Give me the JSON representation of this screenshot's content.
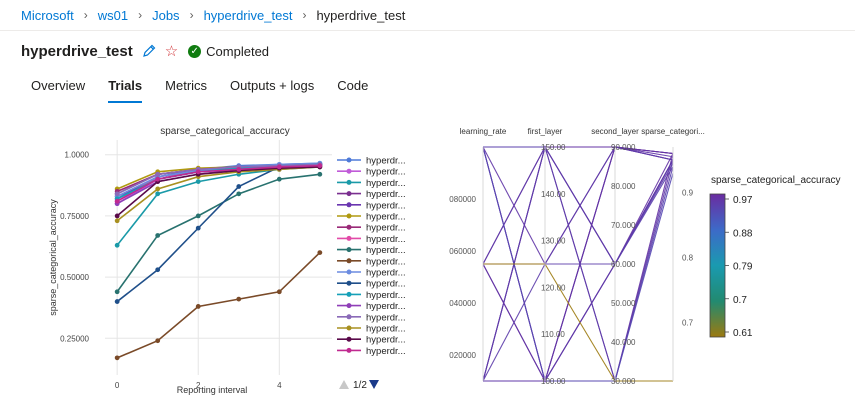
{
  "breadcrumb": [
    "Microsoft",
    "ws01",
    "Jobs",
    "hyperdrive_test",
    "hyperdrive_test"
  ],
  "title": "hyperdrive_test",
  "status": "Completed",
  "tabs": [
    "Overview",
    "Trials",
    "Metrics",
    "Outputs + logs",
    "Code"
  ],
  "active_tab": "Trials",
  "colors": {
    "accent": "#0078d4",
    "completed": "#107c10",
    "star": "#d13438"
  },
  "pager": "1/2",
  "chart_data": [
    {
      "type": "line",
      "title": "sparse_categorical_accuracy",
      "xlabel": "Reporting interval",
      "ylabel": "sparse_categorical_accuracy",
      "xlim": [
        -0.3,
        5.3
      ],
      "ylim": [
        0.1,
        1.06
      ],
      "xticks": [
        0,
        2,
        4
      ],
      "yticks": [
        0.25,
        0.5,
        0.75,
        1.0
      ],
      "ytick_labels": [
        "0.25000",
        "0.50000",
        "0.75000",
        "1.0000"
      ],
      "grid": true,
      "legend_placement": "right",
      "series": [
        {
          "name": "hyperdr...",
          "color": "#4e7ad8",
          "values": [
            0.82,
            0.91,
            0.94,
            0.955,
            0.96,
            0.965
          ]
        },
        {
          "name": "hyperdr...",
          "color": "#c05bd8",
          "values": [
            0.8,
            0.9,
            0.93,
            0.945,
            0.955,
            0.96
          ]
        },
        {
          "name": "hyperdr...",
          "color": "#1a9aa8",
          "values": [
            0.63,
            0.84,
            0.89,
            0.92,
            0.94,
            0.95
          ]
        },
        {
          "name": "hyperdr...",
          "color": "#7a2f8f",
          "values": [
            0.84,
            0.92,
            0.94,
            0.95,
            0.955,
            0.96
          ]
        },
        {
          "name": "hyperdr...",
          "color": "#6a36b0",
          "values": [
            0.83,
            0.9,
            0.93,
            0.945,
            0.95,
            0.955
          ]
        },
        {
          "name": "hyperdr...",
          "color": "#b09a10",
          "values": [
            0.86,
            0.93,
            0.945,
            0.95,
            0.955,
            0.96
          ]
        },
        {
          "name": "hyperdr...",
          "color": "#9a2a78",
          "values": [
            0.85,
            0.92,
            0.94,
            0.95,
            0.955,
            0.96
          ]
        },
        {
          "name": "hyperdr...",
          "color": "#e24aa8",
          "values": [
            0.81,
            0.91,
            0.93,
            0.94,
            0.95,
            0.955
          ]
        },
        {
          "name": "hyperdr...",
          "color": "#28726f",
          "values": [
            0.44,
            0.67,
            0.75,
            0.84,
            0.9,
            0.92
          ]
        },
        {
          "name": "hyperdr...",
          "color": "#7a4a28",
          "values": [
            0.17,
            0.24,
            0.38,
            0.41,
            0.44,
            0.6
          ]
        },
        {
          "name": "hyperdr...",
          "color": "#6c8ce0",
          "values": [
            0.83,
            0.91,
            0.935,
            0.95,
            0.96,
            0.965
          ]
        },
        {
          "name": "hyperdr...",
          "color": "#1f4f8a",
          "values": [
            0.4,
            0.53,
            0.7,
            0.87,
            0.95,
            0.96
          ]
        },
        {
          "name": "hyperdr...",
          "color": "#16a0b8",
          "values": [
            0.82,
            0.9,
            0.93,
            0.945,
            0.955,
            0.96
          ]
        },
        {
          "name": "hyperdr...",
          "color": "#8f3fb8",
          "values": [
            0.8,
            0.89,
            0.92,
            0.94,
            0.95,
            0.955
          ]
        },
        {
          "name": "hyperdr...",
          "color": "#8a6ab8",
          "values": [
            0.84,
            0.92,
            0.94,
            0.95,
            0.955,
            0.96
          ]
        },
        {
          "name": "hyperdr...",
          "color": "#a89020",
          "values": [
            0.73,
            0.86,
            0.91,
            0.93,
            0.94,
            0.95
          ]
        },
        {
          "name": "hyperdr...",
          "color": "#5a0a4a",
          "values": [
            0.75,
            0.89,
            0.92,
            0.935,
            0.945,
            0.95
          ]
        },
        {
          "name": "hyperdr...",
          "color": "#c02a90",
          "values": [
            0.81,
            0.9,
            0.93,
            0.94,
            0.95,
            0.955
          ]
        }
      ]
    },
    {
      "type": "parallel_coordinates",
      "axes": [
        {
          "name": "learning_rate",
          "range": [
            0.01,
            0.1
          ],
          "ticks": [
            0.02,
            0.04,
            0.06,
            0.08
          ],
          "tick_labels": [
            "020000",
            "040000",
            "060000",
            "080000"
          ]
        },
        {
          "name": "first_layer",
          "range": [
            100,
            150
          ],
          "ticks": [
            100,
            110,
            120,
            130,
            140,
            150
          ],
          "tick_labels": [
            "100.00",
            "110.00",
            "120.00",
            "130.00",
            "140.00",
            "150.00"
          ]
        },
        {
          "name": "second_layer",
          "range": [
            30,
            90
          ],
          "ticks": [
            30,
            40,
            50,
            60,
            70,
            80,
            90
          ],
          "tick_labels": [
            "30.000",
            "40.000",
            "50.000",
            "60.000",
            "70.000",
            "80.000",
            "90.000"
          ]
        },
        {
          "name": "sparse_categori...",
          "range": [
            0.61,
            0.97
          ],
          "ticks": [
            0.7,
            0.8,
            0.9
          ],
          "tick_labels": [
            "0.7",
            "0.8",
            "0.9"
          ]
        }
      ],
      "lines": [
        [
          0.1,
          150,
          90,
          0.96
        ],
        [
          0.1,
          100,
          90,
          0.95
        ],
        [
          0.1,
          150,
          60,
          0.95
        ],
        [
          0.1,
          100,
          60,
          0.96
        ],
        [
          0.1,
          150,
          30,
          0.94
        ],
        [
          0.01,
          150,
          90,
          0.96
        ],
        [
          0.01,
          100,
          90,
          0.95
        ],
        [
          0.01,
          150,
          60,
          0.94
        ],
        [
          0.01,
          100,
          30,
          0.96
        ],
        [
          0.01,
          150,
          30,
          0.95
        ],
        [
          0.055,
          150,
          90,
          0.96
        ],
        [
          0.055,
          100,
          60,
          0.95
        ],
        [
          0.055,
          150,
          60,
          0.95
        ],
        [
          0.1,
          100,
          30,
          0.93
        ],
        [
          0.055,
          100,
          90,
          0.96
        ],
        [
          0.01,
          100,
          60,
          0.95
        ],
        [
          0.1,
          125,
          90,
          0.955
        ],
        [
          0.01,
          125,
          60,
          0.945
        ],
        [
          0.055,
          125,
          90,
          0.95
        ],
        [
          0.055,
          125,
          30,
          0.61
        ]
      ],
      "colorbar": {
        "title": "sparse_categorical_accuracy",
        "range": [
          0.61,
          0.97
        ],
        "tick_labels": [
          "0.97",
          "0.88",
          "0.79",
          "0.7",
          "0.61"
        ],
        "stops": [
          "#9c7a10",
          "#228a70",
          "#1a9ab0",
          "#3d6ac8",
          "#6a2ca0"
        ]
      }
    }
  ]
}
